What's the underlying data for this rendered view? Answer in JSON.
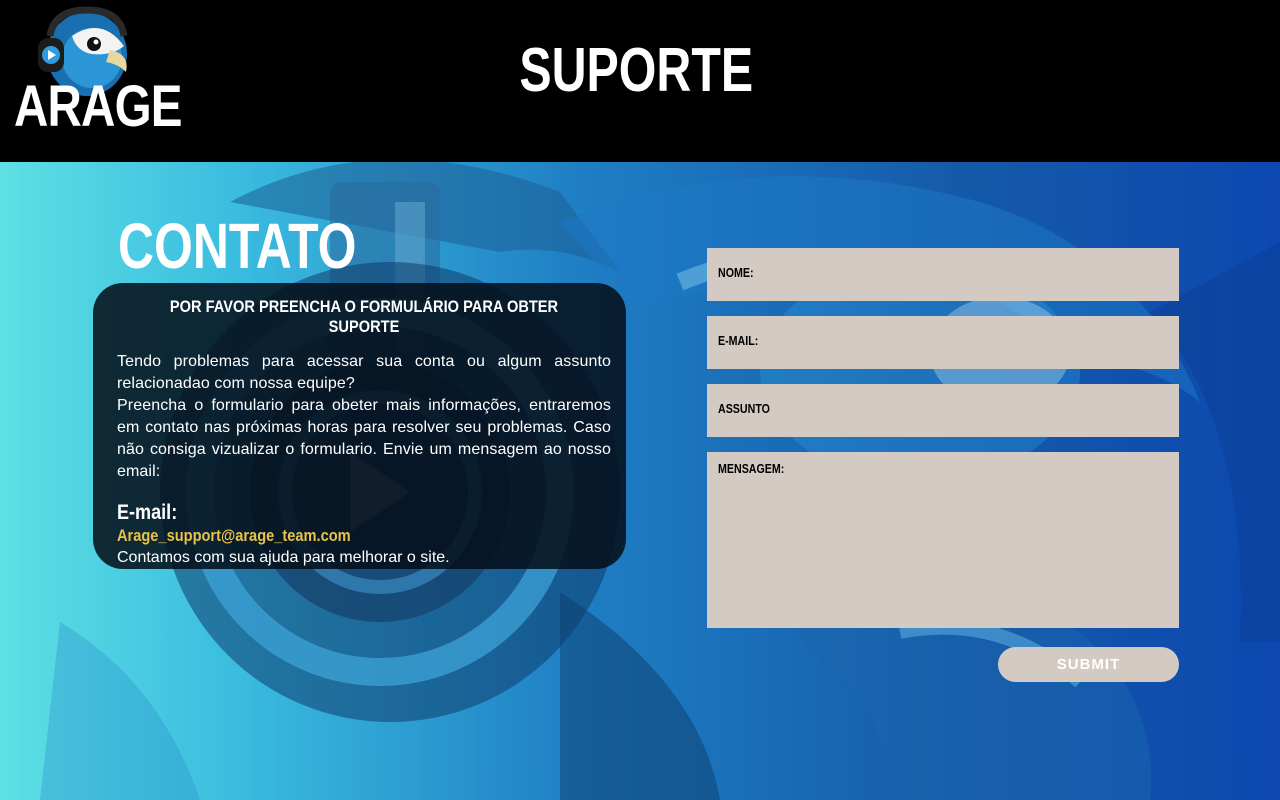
{
  "brand": {
    "logo_text": "ARAGE",
    "logo_icon": "parrot-with-headphones-icon"
  },
  "header": {
    "title": "SUPORTE"
  },
  "contato": {
    "title": "CONTATO",
    "heading": "POR FAVOR PREENCHA O FORMULÁRIO PARA OBTER SUPORTE",
    "paragraph_1": "Tendo problemas para acessar sua conta ou algum assunto relacionadao com nossa equipe?",
    "paragraph_2": "Preencha o formulario para obeter mais informações, entraremos em contato nas próximas horas para resolver seu problemas. Caso não consiga vizualizar o formulario. Envie um mensagem ao nosso email:",
    "email_label": "E-mail:",
    "email_value": "Arage_support@arage_team.com",
    "closing": "Contamos com sua ajuda para melhorar o site."
  },
  "form": {
    "nome_label": "NOME:",
    "email_label": "E-MAIL:",
    "assunto_label": "ASSUNTO",
    "mensagem_label": "MENSAGEM:",
    "submit_label": "SUBMIT"
  },
  "colors": {
    "header_bg": "#000000",
    "field_bg": "#d4cac4",
    "email_accent": "#e8c24a",
    "card_bg": "#050e18"
  }
}
